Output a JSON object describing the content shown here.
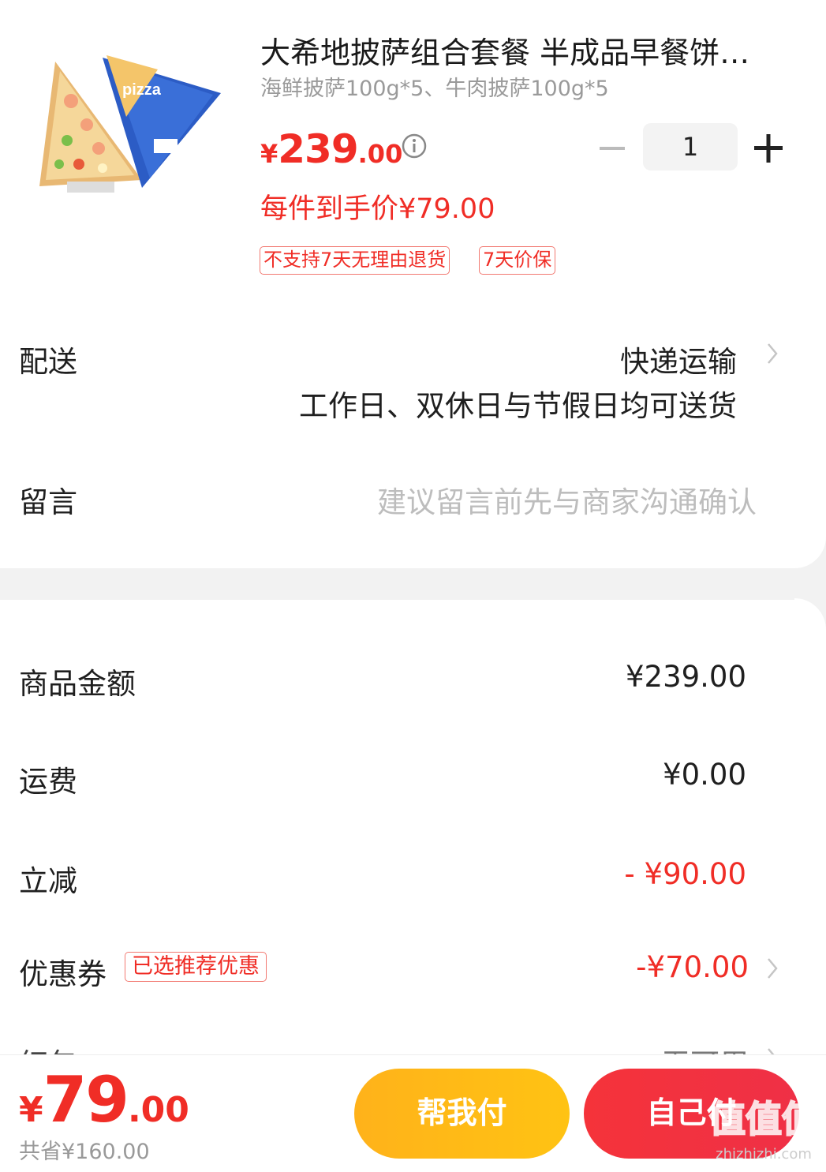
{
  "product": {
    "title": "大希地披萨组合套餐 半成品早餐饼…",
    "spec": "海鲜披萨100g*5、牛肉披萨100g*5",
    "image_label": "pizza",
    "price_currency": "¥",
    "price_int": "239",
    "price_dec": ".00",
    "unit_price": "每件到手价¥79.00",
    "quantity": "1",
    "tags": [
      "不支持7天无理由退货",
      "7天价保"
    ]
  },
  "shipping": {
    "label": "配送",
    "method": "快递运输",
    "note": "工作日、双休日与节假日均可送货"
  },
  "message": {
    "label": "留言",
    "placeholder": "建议留言前先与商家沟通确认"
  },
  "summary": {
    "goods_label": "商品金额",
    "goods_value": "¥239.00",
    "freight_label": "运费",
    "freight_value": "¥0.00",
    "discount_label": "立减",
    "discount_value": "- ¥90.00",
    "coupon_label": "优惠券",
    "coupon_tag": "已选推荐优惠",
    "coupon_value": "-¥70.00",
    "redpack_label": "红包",
    "redpack_value": "无可用"
  },
  "footer": {
    "total_currency": "¥",
    "total_int": "79",
    "total_dec": ".00",
    "saved": "共省¥160.00",
    "help_pay": "帮我付",
    "self_pay": "自己付",
    "watermark": "值值值",
    "watermark_url": "zhizhizhi.com"
  },
  "colors": {
    "accent_red": "#f02d26",
    "btn_yellow": "#ffb21a",
    "btn_red": "#f5333a",
    "muted_gray": "#9a9a9a"
  },
  "icons": [
    "info-icon",
    "minus-icon",
    "plus-icon",
    "chevron-right-icon"
  ]
}
